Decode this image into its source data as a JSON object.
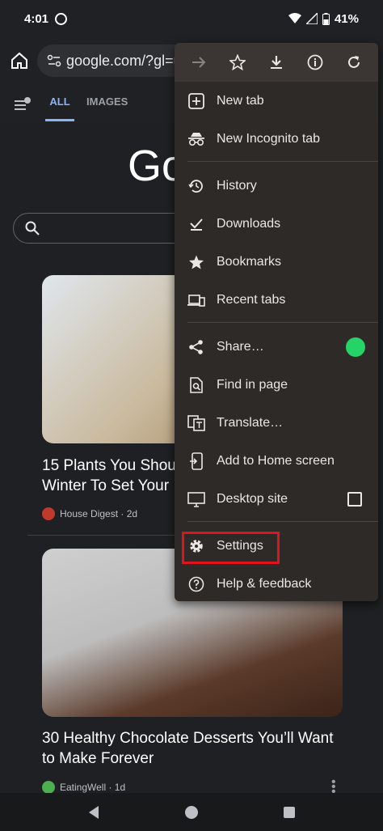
{
  "status_bar": {
    "time": "4:01",
    "battery": "41%"
  },
  "toolbar": {
    "url": "google.com/?gl=us"
  },
  "search_tabs": {
    "all": "ALL",
    "images": "IMAGES"
  },
  "logo_text": "Go",
  "cards": [
    {
      "title": "15 Plants You Shoul\nWinter To Set Your",
      "title_l1": "15 Plants You Shoul",
      "title_l2": "Winter To Set Your",
      "source": "House Digest · 2d"
    },
    {
      "title_l1": "30 Healthy Chocolate Desserts You’ll Want",
      "title_l2": "to Make Forever",
      "source": "EatingWell · 1d"
    }
  ],
  "menu": {
    "top_icons": [
      "forward-icon",
      "star-icon",
      "download-icon",
      "info-icon",
      "refresh-icon"
    ],
    "items": [
      {
        "label": "New tab"
      },
      {
        "label": "New Incognito tab"
      },
      {
        "label": "History"
      },
      {
        "label": "Downloads"
      },
      {
        "label": "Bookmarks"
      },
      {
        "label": "Recent tabs"
      },
      {
        "label": "Share…"
      },
      {
        "label": "Find in page"
      },
      {
        "label": "Translate…"
      },
      {
        "label": "Add to Home screen"
      },
      {
        "label": "Desktop site"
      },
      {
        "label": "Settings"
      },
      {
        "label": "Help & feedback"
      }
    ]
  },
  "colors": {
    "accent": "#8ab4f8",
    "highlight": "#e0141e",
    "whatsapp": "#25d366",
    "menu_bg": "#2e2a28"
  }
}
